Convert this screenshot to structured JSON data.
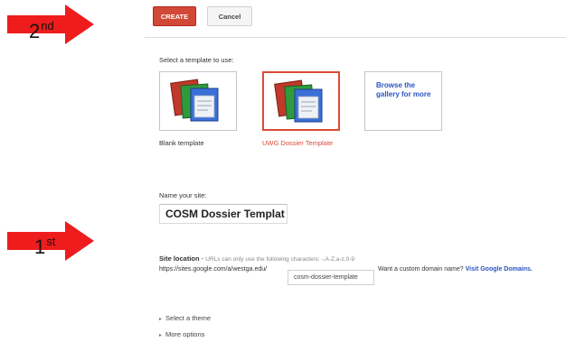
{
  "annotations": {
    "second": {
      "number": "2",
      "suffix": "nd",
      "color": "#ee1c1c"
    },
    "first": {
      "number": "1",
      "suffix": "st",
      "color": "#ee1c1c"
    }
  },
  "toolbar": {
    "create_label": "CREATE",
    "cancel_label": "Cancel"
  },
  "templates": {
    "heading": "Select a template to use:",
    "items": [
      {
        "caption": "Blank template",
        "selected": false
      },
      {
        "caption": "UWG Dossier Template",
        "selected": true
      },
      {
        "caption": "Browse the gallery for more",
        "selected": false
      }
    ]
  },
  "site_name": {
    "label": "Name your site:",
    "value": "COSM Dossier Templat"
  },
  "site_location": {
    "title": "Site location",
    "hint": "URLs can only use the following characters: -,A-Z,a-z,0-9",
    "url_prefix": "https://sites.google.com/a/westga.edu/",
    "url_value": "cosm-dossier-template",
    "custom_domain_text": "Want a custom domain name?",
    "custom_domain_link": "Visit Google Domains."
  },
  "options": [
    "Select a theme",
    "More options"
  ],
  "colors": {
    "accent": "#d14836",
    "selected_border": "#dd4b39",
    "link": "#2a54c5"
  }
}
